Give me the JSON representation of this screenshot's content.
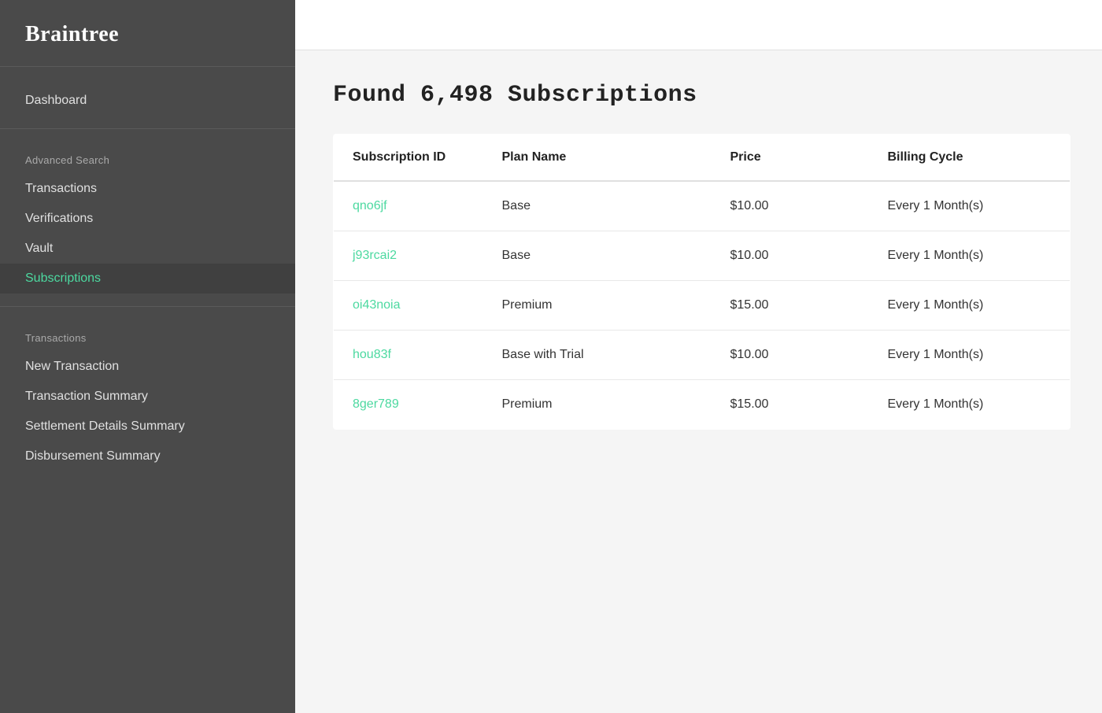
{
  "sidebar": {
    "logo": "Braintree",
    "standalone_items": [
      {
        "label": "Dashboard",
        "id": "dashboard",
        "active": false
      }
    ],
    "advanced_search_label": "Advanced Search",
    "advanced_search_items": [
      {
        "label": "Transactions",
        "id": "transactions",
        "active": false
      },
      {
        "label": "Verifications",
        "id": "verifications",
        "active": false
      },
      {
        "label": "Vault",
        "id": "vault",
        "active": false
      },
      {
        "label": "Subscriptions",
        "id": "subscriptions",
        "active": true
      }
    ],
    "transactions_label": "Transactions",
    "transactions_items": [
      {
        "label": "New Transaction",
        "id": "new-transaction",
        "active": false
      },
      {
        "label": "Transaction Summary",
        "id": "transaction-summary",
        "active": false
      },
      {
        "label": "Settlement Details Summary",
        "id": "settlement-details",
        "active": false
      },
      {
        "label": "Disbursement Summary",
        "id": "disbursement-summary",
        "active": false
      }
    ]
  },
  "main": {
    "results_title": "Found 6,498 Subscriptions",
    "table": {
      "columns": [
        {
          "id": "subscription_id",
          "label": "Subscription ID"
        },
        {
          "id": "plan_name",
          "label": "Plan Name"
        },
        {
          "id": "price",
          "label": "Price"
        },
        {
          "id": "billing_cycle",
          "label": "Billing Cycle"
        }
      ],
      "rows": [
        {
          "subscription_id": "qno6jf",
          "plan_name": "Base",
          "price": "$10.00",
          "billing_cycle": "Every 1 Month(s)"
        },
        {
          "subscription_id": "j93rcai2",
          "plan_name": "Base",
          "price": "$10.00",
          "billing_cycle": "Every 1 Month(s)"
        },
        {
          "subscription_id": "oi43noia",
          "plan_name": "Premium",
          "price": "$15.00",
          "billing_cycle": "Every 1 Month(s)"
        },
        {
          "subscription_id": "hou83f",
          "plan_name": "Base with Trial",
          "price": "$10.00",
          "billing_cycle": "Every 1 Month(s)"
        },
        {
          "subscription_id": "8ger789",
          "plan_name": "Premium",
          "price": "$15.00",
          "billing_cycle": "Every 1 Month(s)"
        }
      ]
    }
  }
}
